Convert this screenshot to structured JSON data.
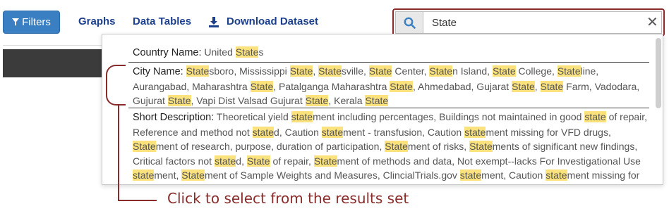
{
  "toolbar": {
    "filters_label": "Filters",
    "graphs_label": "Graphs",
    "data_tables_label": "Data Tables",
    "download_label": "Download Dataset"
  },
  "search": {
    "value": "State",
    "clear_label": "✕"
  },
  "results": [
    {
      "field": "Country Name:",
      "segments": [
        [
          "United ",
          false
        ],
        [
          "State",
          true
        ],
        [
          "s",
          false
        ]
      ]
    },
    {
      "field": "City Name:",
      "segments": [
        [
          "State",
          true
        ],
        [
          "sboro, Mississippi ",
          false
        ],
        [
          "State",
          true
        ],
        [
          ", ",
          false
        ],
        [
          "State",
          true
        ],
        [
          "sville, ",
          false
        ],
        [
          "State",
          true
        ],
        [
          " Center, ",
          false
        ],
        [
          "State",
          true
        ],
        [
          "n Island, ",
          false
        ],
        [
          "State",
          true
        ],
        [
          " College, ",
          false
        ],
        [
          "State",
          true
        ],
        [
          "line, Aurangabad, Maharashtra ",
          false
        ],
        [
          "State",
          true
        ],
        [
          ", Patalganga Maharashtra ",
          false
        ],
        [
          "State",
          true
        ],
        [
          ", Ahmedabad, Gujarat ",
          false
        ],
        [
          "State",
          true
        ],
        [
          ", ",
          false
        ],
        [
          "State",
          true
        ],
        [
          " Farm, Vadodara, Gujurat ",
          false
        ],
        [
          "State",
          true
        ],
        [
          ", Vapi Dist Valsad Gujurat ",
          false
        ],
        [
          "State",
          true
        ],
        [
          ", Kerala ",
          false
        ],
        [
          "State",
          true
        ]
      ]
    },
    {
      "field": "Short Description:",
      "segments": [
        [
          "Theoretical yield ",
          false
        ],
        [
          "state",
          true
        ],
        [
          "ment including percentages, Buildings not maintained in good ",
          false
        ],
        [
          "state",
          true
        ],
        [
          " of repair, Reference and method not ",
          false
        ],
        [
          "state",
          true
        ],
        [
          "d, Caution ",
          false
        ],
        [
          "state",
          true
        ],
        [
          "ment - transfusion, Caution ",
          false
        ],
        [
          "state",
          true
        ],
        [
          "ment missing for VFD drugs, ",
          false
        ],
        [
          "State",
          true
        ],
        [
          "ment of research, purpose, duration of participation, ",
          false
        ],
        [
          "State",
          true
        ],
        [
          "ment of risks, ",
          false
        ],
        [
          "State",
          true
        ],
        [
          "ments of significant new findings, Critical factors not ",
          false
        ],
        [
          "state",
          true
        ],
        [
          "d, ",
          false
        ],
        [
          "State",
          true
        ],
        [
          " of repair, ",
          false
        ],
        [
          "State",
          true
        ],
        [
          "ment of methods and data, Not exempt--lacks For Investigational Use ",
          false
        ],
        [
          "state",
          true
        ],
        [
          "ment, ",
          false
        ],
        [
          "State",
          true
        ],
        [
          "ment of Sample Weights and Measures, ClincialTrials.gov ",
          false
        ],
        [
          "state",
          true
        ],
        [
          "ment, Caution ",
          false
        ],
        [
          "state",
          true
        ],
        [
          "ment missing for VFD feeds, No",
          false
        ]
      ]
    }
  ],
  "callout": {
    "text": "Click to select from the results set"
  },
  "colors": {
    "primary": "#3a7fc1",
    "link": "#1b3f8c",
    "highlight": "#fbe27d",
    "annotation": "#8a2b2b"
  },
  "icons": [
    "filter-icon",
    "download-icon",
    "search-icon",
    "close-icon"
  ]
}
